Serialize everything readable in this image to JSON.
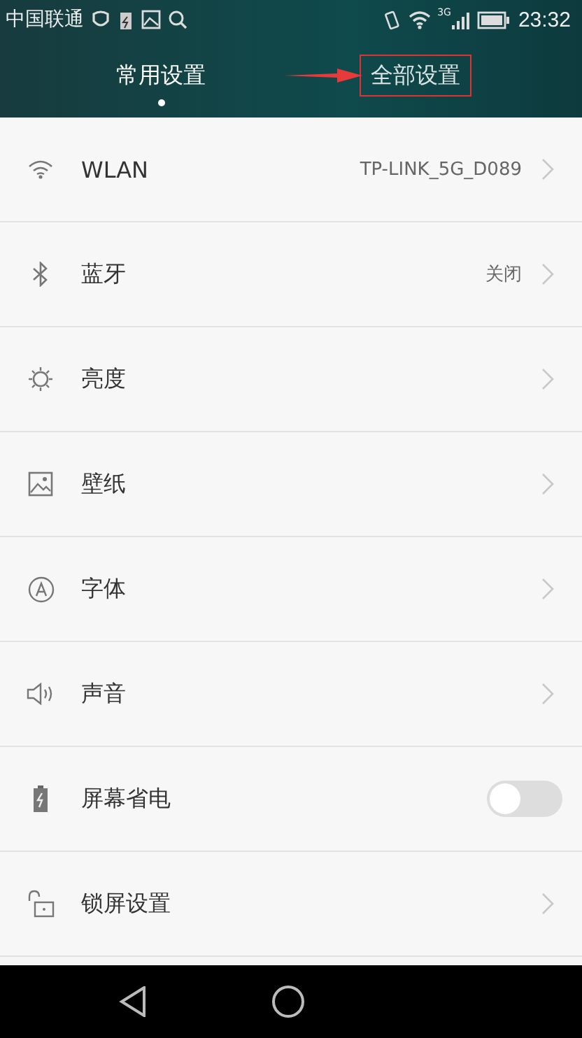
{
  "status_bar": {
    "carrier": "中国联通",
    "network": "3G",
    "time": "23:32"
  },
  "tabs": [
    {
      "label": "常用设置",
      "selected": true,
      "highlighted": false
    },
    {
      "label": "全部设置",
      "selected": false,
      "highlighted": true
    }
  ],
  "settings": [
    {
      "label": "WLAN",
      "value": "TP-LINK_5G_D089",
      "kind": "link"
    },
    {
      "label": "蓝牙",
      "value": "关闭",
      "kind": "link"
    },
    {
      "label": "亮度",
      "kind": "link"
    },
    {
      "label": "壁纸",
      "kind": "link"
    },
    {
      "label": "字体",
      "kind": "link"
    },
    {
      "label": "声音",
      "kind": "link"
    },
    {
      "label": "屏幕省电",
      "kind": "toggle",
      "on": false
    },
    {
      "label": "锁屏设置",
      "kind": "link"
    }
  ]
}
